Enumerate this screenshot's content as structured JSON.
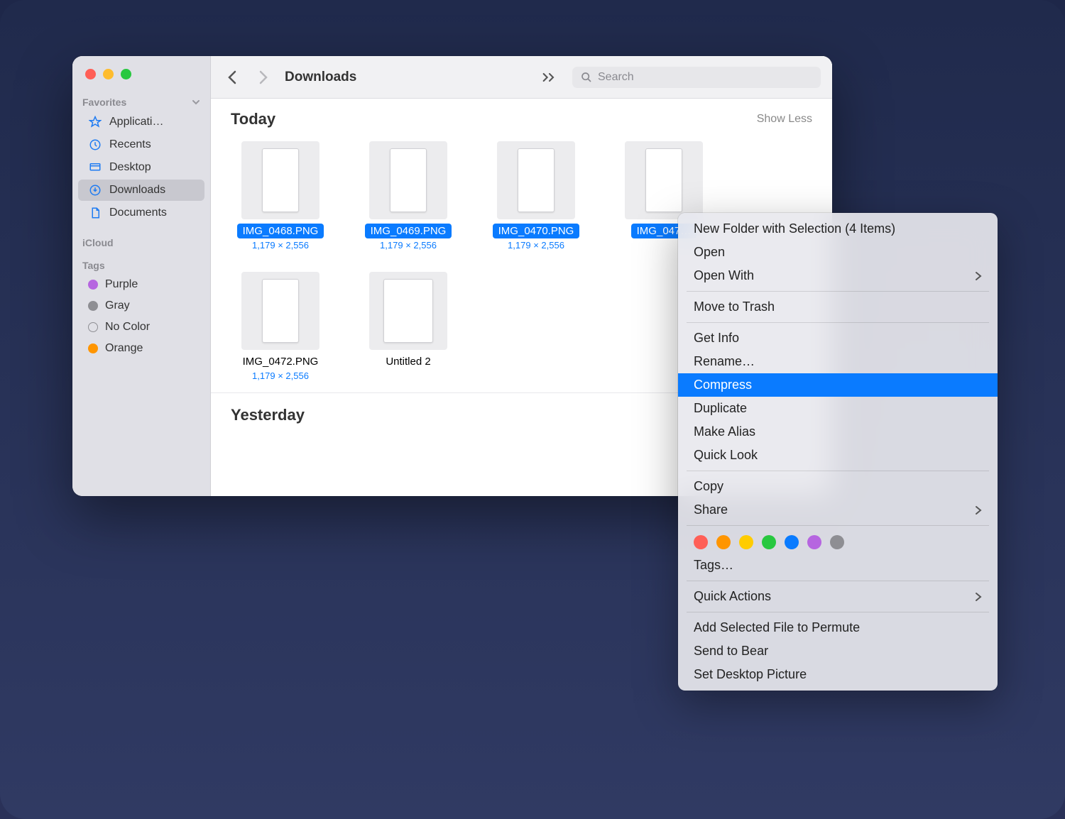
{
  "window": {
    "title": "Downloads"
  },
  "sidebar": {
    "favorites_label": "Favorites",
    "icloud_label": "iCloud",
    "tags_label": "Tags",
    "items": [
      {
        "label": "Applicati…"
      },
      {
        "label": "Recents"
      },
      {
        "label": "Desktop"
      },
      {
        "label": "Downloads"
      },
      {
        "label": "Documents"
      }
    ],
    "tags": [
      {
        "label": "Purple"
      },
      {
        "label": "Gray"
      },
      {
        "label": "No Color"
      },
      {
        "label": "Orange"
      }
    ]
  },
  "search": {
    "placeholder": "Search"
  },
  "groups": {
    "today": {
      "title": "Today",
      "show_less": "Show Less"
    },
    "yesterday": {
      "title": "Yesterday"
    }
  },
  "files": {
    "today": [
      {
        "name": "IMG_0468.PNG",
        "dims": "1,179 × 2,556",
        "selected": true
      },
      {
        "name": "IMG_0469.PNG",
        "dims": "1,179 × 2,556",
        "selected": true
      },
      {
        "name": "IMG_0470.PNG",
        "dims": "1,179 × 2,556",
        "selected": true
      },
      {
        "name": "IMG_047…",
        "dims": "",
        "selected": true
      },
      {
        "name": "IMG_0472.PNG",
        "dims": "1,179 × 2,556",
        "selected": false
      },
      {
        "name": "Untitled 2",
        "dims": "",
        "selected": false,
        "type": "spreadsheet"
      }
    ]
  },
  "context_menu": {
    "items": [
      {
        "label": "New Folder with Selection (4 Items)"
      },
      {
        "label": "Open"
      },
      {
        "label": "Open With",
        "submenu": true
      },
      {
        "sep": true
      },
      {
        "label": "Move to Trash"
      },
      {
        "sep": true
      },
      {
        "label": "Get Info"
      },
      {
        "label": "Rename…"
      },
      {
        "label": "Compress",
        "highlighted": true
      },
      {
        "label": "Duplicate"
      },
      {
        "label": "Make Alias"
      },
      {
        "label": "Quick Look"
      },
      {
        "sep": true
      },
      {
        "label": "Copy"
      },
      {
        "label": "Share",
        "submenu": true
      },
      {
        "sep": true
      },
      {
        "tags": true
      },
      {
        "label": "Tags…"
      },
      {
        "sep": true
      },
      {
        "label": "Quick Actions",
        "submenu": true
      },
      {
        "sep": true
      },
      {
        "label": "Add Selected File to Permute"
      },
      {
        "label": "Send to Bear"
      },
      {
        "label": "Set Desktop Picture"
      }
    ]
  }
}
